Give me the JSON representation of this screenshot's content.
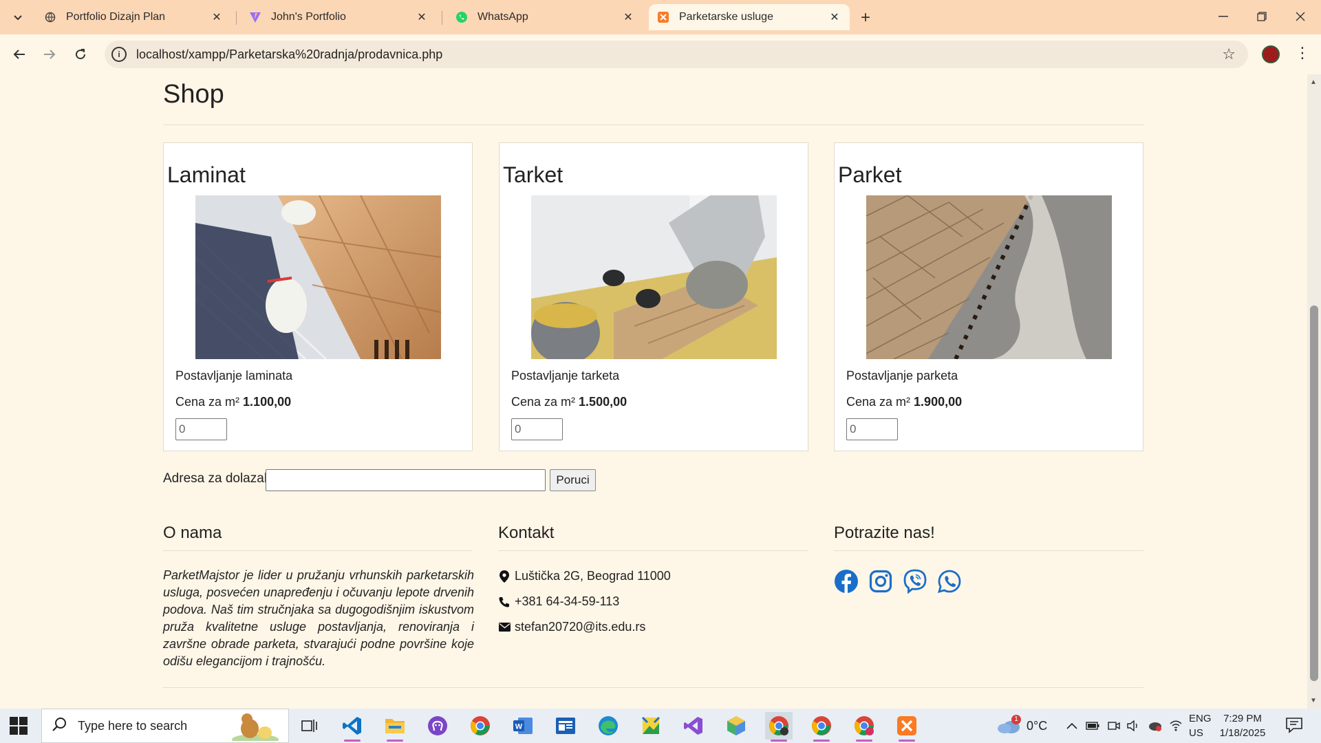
{
  "browser": {
    "tabs": [
      {
        "label": "Portfolio Dizajn Plan",
        "icon": "globe-icon"
      },
      {
        "label": "John's Portfolio",
        "icon": "vite-icon"
      },
      {
        "label": "WhatsApp",
        "icon": "whatsapp-icon"
      },
      {
        "label": "Parketarske usluge",
        "icon": "xampp-icon",
        "active": true
      }
    ],
    "url": "localhost/xampp/Parketarska%20radnja/prodavnica.php"
  },
  "page": {
    "shop_title": "Shop",
    "products": [
      {
        "title": "Laminat",
        "desc": "Postavljanje laminata",
        "price_label": "Cena za m² ",
        "price": "1.100,00",
        "qty": "0"
      },
      {
        "title": "Tarket",
        "desc": "Postavljanje tarketa",
        "price_label": "Cena za m² ",
        "price": "1.500,00",
        "qty": "0"
      },
      {
        "title": "Parket",
        "desc": "Postavljanje parketa",
        "price_label": "Cena za m² ",
        "price": "1.900,00",
        "qty": "0"
      }
    ],
    "order": {
      "label": "Adresa za dolazak",
      "address": "",
      "button": "Poruci"
    },
    "footer": {
      "about_title": "O nama",
      "about_text": "ParketMajstor je lider u pružanju vrhunskih parketarskih usluga, posvećen unapređenju i očuvanju lepote drvenih podova. Naš tim stručnjaka sa dugogodišnjim iskustvom pruža kvalitetne usluge postavljanja, renoviranja i završne obrade parketa, stvarajući podne površine koje odišu elegancijom i trajnošću.",
      "contact_title": "Kontakt",
      "address": "Luštička 2G, Beograd 11000",
      "phone": "+381 64-34-59-113",
      "email": "stefan20720@its.edu.rs",
      "social_title": "Potrazite nas!",
      "social": [
        "facebook-icon",
        "instagram-icon",
        "viber-icon",
        "whatsapp-icon"
      ]
    }
  },
  "taskbar": {
    "search_placeholder": "Type here to search",
    "weather": "0°C",
    "lang1": "ENG",
    "lang2": "US",
    "time": "7:29 PM",
    "date": "1/18/2025",
    "weather_badge": "1"
  },
  "colors": {
    "accent": "#1a6ec9",
    "tabbar": "#fcd7b5",
    "page_bg": "#fef6e7"
  }
}
